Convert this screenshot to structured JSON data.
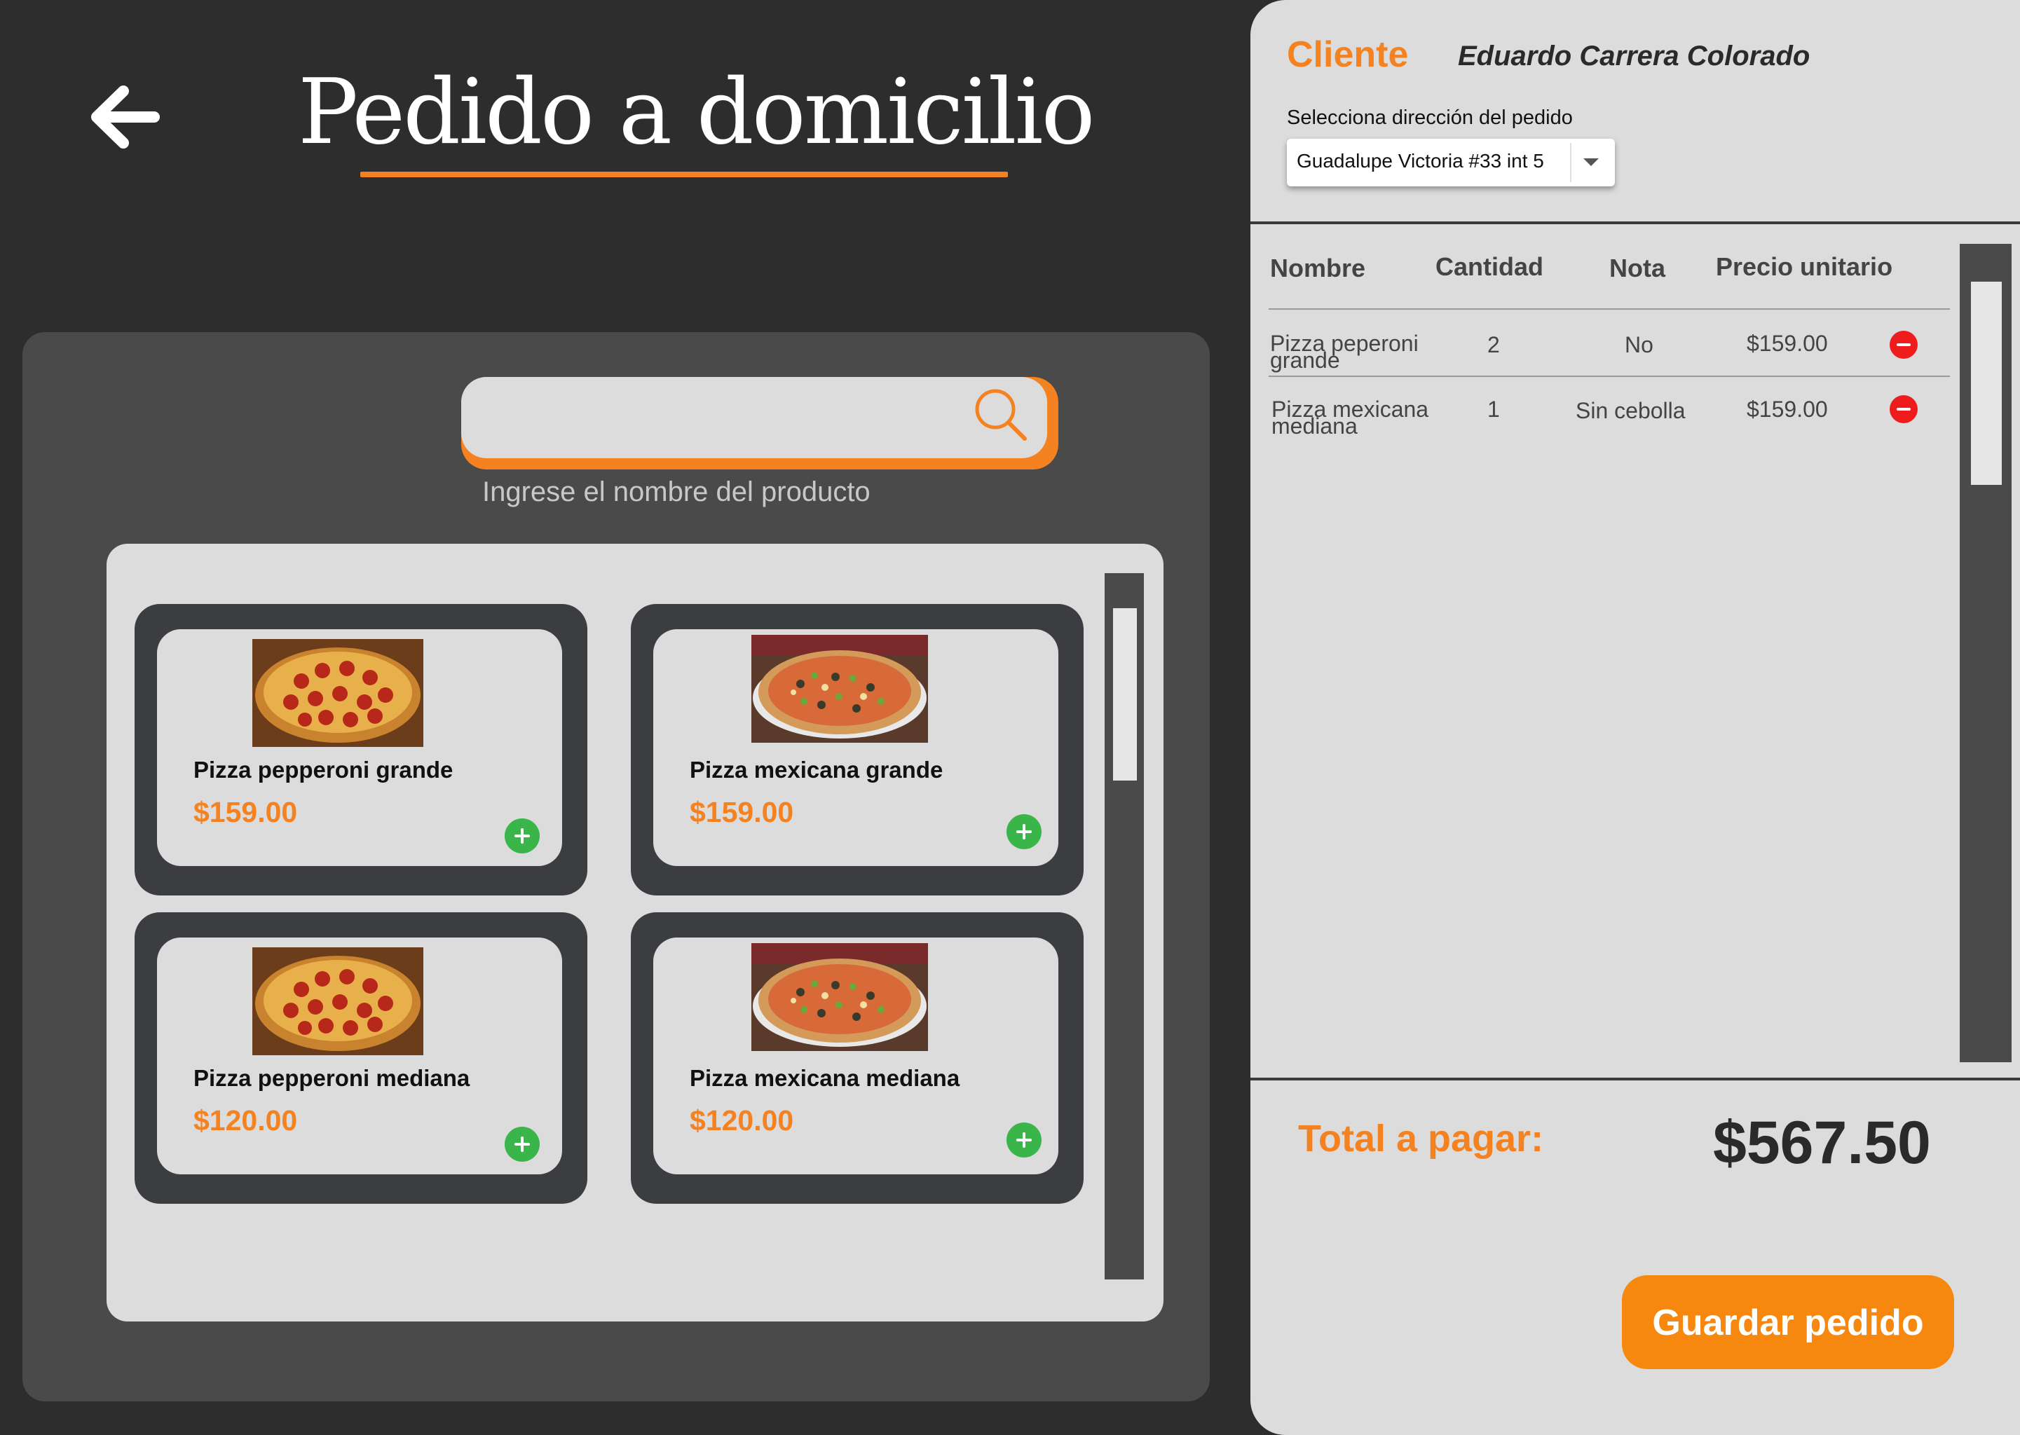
{
  "header": {
    "title": "Pedido a domicilio",
    "back_icon": "arrow-left-icon"
  },
  "search": {
    "value": "",
    "hint": "Ingrese el nombre del producto",
    "icon": "search-icon"
  },
  "products": [
    {
      "name": "Pizza pepperoni grande",
      "price": "$159.00",
      "image": "pepperoni-pizza"
    },
    {
      "name": "Pizza mexicana grande",
      "price": "$159.00",
      "image": "mexicana-pizza"
    },
    {
      "name": "Pizza pepperoni mediana",
      "price": "$120.00",
      "image": "pepperoni-pizza"
    },
    {
      "name": "Pizza mexicana mediana",
      "price": "$120.00",
      "image": "mexicana-pizza"
    }
  ],
  "order": {
    "client_label": "Cliente",
    "client_name": "Eduardo Carrera Colorado",
    "address_label": "Selecciona dirección del pedido",
    "address_value": "Guadalupe Victoria #33 int 5",
    "columns": [
      "Nombre",
      "Cantidad",
      "Nota",
      "Precio unitario"
    ],
    "rows": [
      {
        "name_line1": "Pizza peperoni",
        "name_line2": "grande",
        "qty": "2",
        "note": "No",
        "price": "$159.00"
      },
      {
        "name_line1": "Pizza mexicana",
        "name_line2": "mediana",
        "qty": "1",
        "note": "Sin cebolla",
        "price": "$159.00"
      }
    ],
    "total_label": "Total a pagar:",
    "total_value": "$567.50",
    "save_label": "Guardar pedido"
  },
  "colors": {
    "accent": "#f58220",
    "background": "#2d2d2d",
    "panel": "#4a4a4a",
    "card": "#dcdcdc",
    "add": "#3ab54a",
    "remove": "#ee1c1c"
  }
}
